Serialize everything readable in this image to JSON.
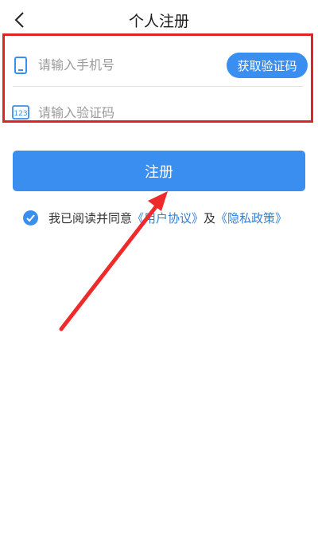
{
  "header": {
    "title": "个人注册"
  },
  "form": {
    "phone_placeholder": "请输入手机号",
    "code_placeholder": "请输入验证码",
    "get_code_label": "获取验证码",
    "code_icon_text": "123"
  },
  "register_label": "注册",
  "agreement": {
    "prefix": "我已阅读并同意",
    "user_agreement": "《用户协议》",
    "conjunction": "及",
    "privacy_policy": "《隐私政策》"
  },
  "colors": {
    "primary": "#3a8ef0",
    "highlight_border": "#e02424",
    "link": "#2f7fd8"
  },
  "icons": {
    "back": "chevron-left-icon",
    "phone": "phone-icon",
    "code": "numeric-code-icon",
    "check": "check-circle-icon"
  }
}
